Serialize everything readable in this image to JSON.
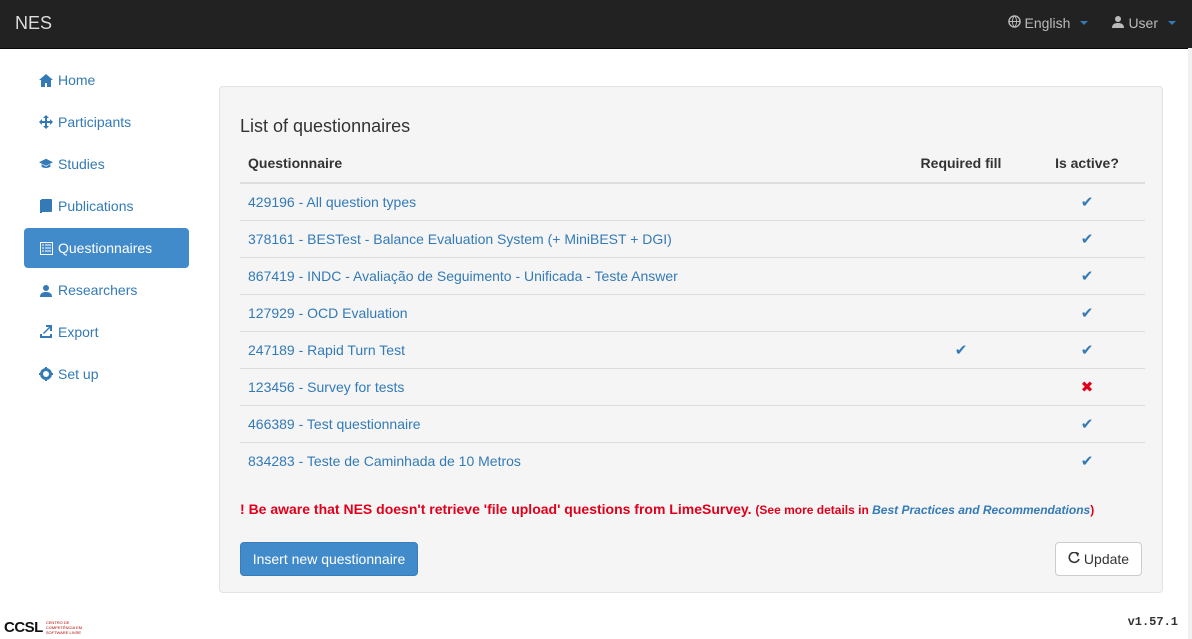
{
  "navbar": {
    "brand": "NES",
    "language": "English",
    "user": "User"
  },
  "sidebar": {
    "items": [
      {
        "label": "Home",
        "icon": "home-icon"
      },
      {
        "label": "Participants",
        "icon": "move-icon"
      },
      {
        "label": "Studies",
        "icon": "education-icon"
      },
      {
        "label": "Publications",
        "icon": "book-icon"
      },
      {
        "label": "Questionnaires",
        "icon": "list-alt-icon",
        "active": true
      },
      {
        "label": "Researchers",
        "icon": "user-icon"
      },
      {
        "label": "Export",
        "icon": "export-icon"
      },
      {
        "label": "Set up",
        "icon": "cog-icon"
      }
    ]
  },
  "main": {
    "title": "List of questionnaires",
    "columns": [
      "Questionnaire",
      "Required fill",
      "Is active?"
    ],
    "rows": [
      {
        "name": "429196 - All question types",
        "required": false,
        "active": true
      },
      {
        "name": "378161 - BESTest - Balance Evaluation System (+ MiniBEST + DGI)",
        "required": false,
        "active": true
      },
      {
        "name": "867419 - INDC - Avaliação de Seguimento - Unificada - Teste Answer",
        "required": false,
        "active": true
      },
      {
        "name": "127929 - OCD Evaluation",
        "required": false,
        "active": true
      },
      {
        "name": "247189 - Rapid Turn Test",
        "required": true,
        "active": true
      },
      {
        "name": "123456 - Survey for tests",
        "required": false,
        "active": false
      },
      {
        "name": "466389 - Test questionnaire",
        "required": false,
        "active": true
      },
      {
        "name": "834283 - Teste de Caminhada de 10 Metros",
        "required": false,
        "active": true
      }
    ],
    "warning": {
      "mark": "!",
      "text": "Be aware that NES doesn't retrieve 'file upload' questions from LimeSurvey.",
      "details_prefix": "(See more details in",
      "details_link": "Best Practices and Recommendations",
      "details_suffix": ")"
    },
    "insert_button": "Insert new questionnaire",
    "update_button": "Update"
  },
  "footer": {
    "logo": "CCSL",
    "logo_small": "CENTRO DE COMPETÊNCIA EM SOFTWARE LIVRE",
    "version": "v1.57.1"
  },
  "colors": {
    "accent": "#428bca",
    "link": "#337ab7",
    "danger": "#e0001b",
    "navbar": "#222222"
  }
}
